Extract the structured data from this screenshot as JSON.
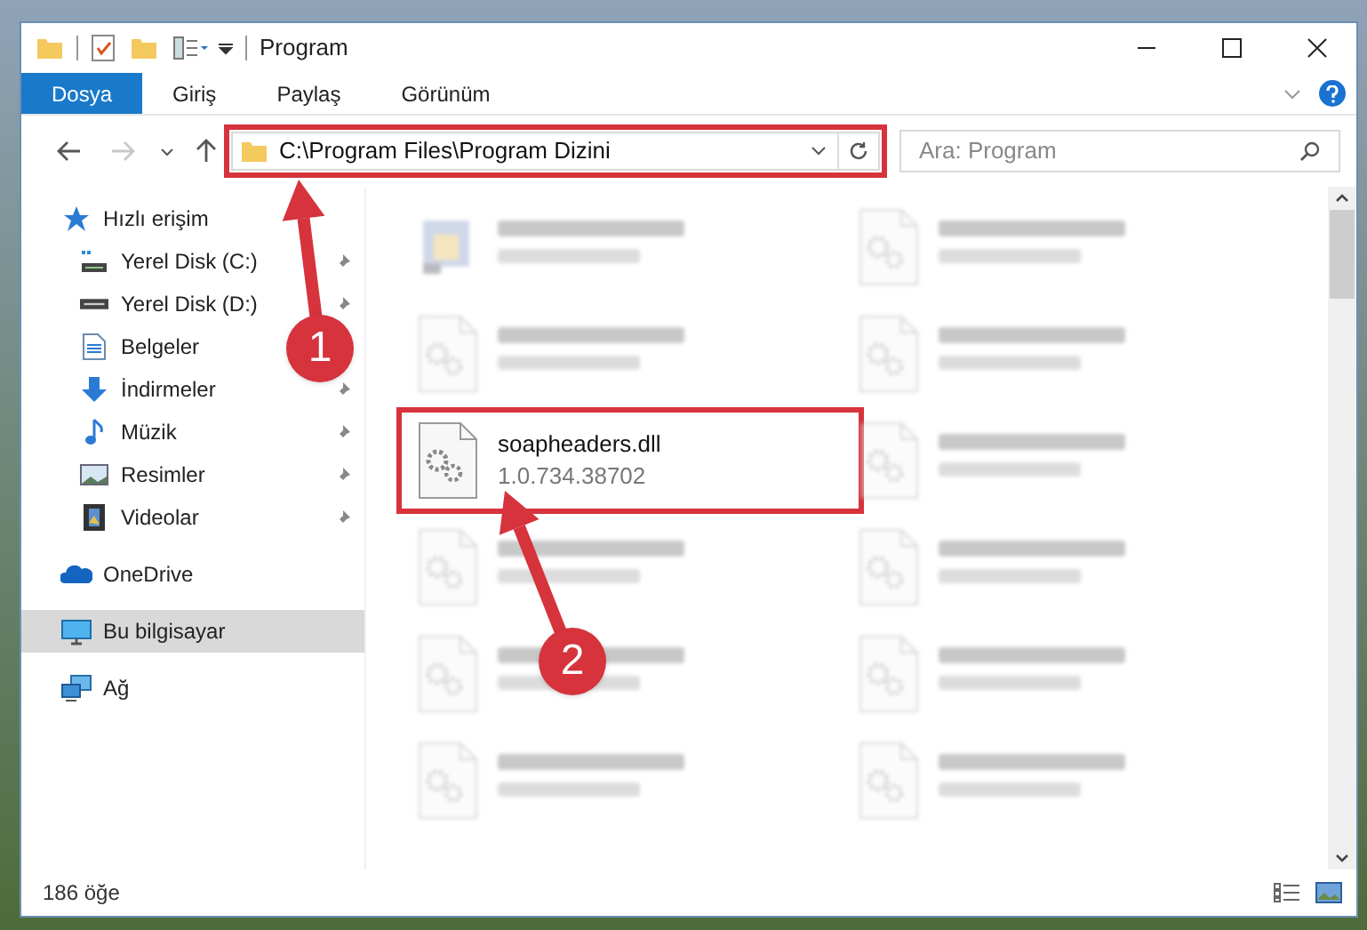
{
  "window": {
    "title": "Program"
  },
  "ribbon_tabs": [
    {
      "label": "Dosya",
      "selected": true
    },
    {
      "label": "Giriş",
      "selected": false
    },
    {
      "label": "Paylaş",
      "selected": false
    },
    {
      "label": "Görünüm",
      "selected": false
    }
  ],
  "address_bar": {
    "path": "C:\\Program Files\\Program Dizini"
  },
  "search": {
    "placeholder": "Ara: Program"
  },
  "sidebar": {
    "items": [
      {
        "label": "Hızlı erişim",
        "group": true,
        "pinned": false,
        "selected": false
      },
      {
        "label": "Yerel Disk (C:)",
        "group": false,
        "pinned": true,
        "selected": false
      },
      {
        "label": "Yerel Disk (D:)",
        "group": false,
        "pinned": true,
        "selected": false
      },
      {
        "label": "Belgeler",
        "group": false,
        "pinned": false,
        "selected": false
      },
      {
        "label": "İndirmeler",
        "group": false,
        "pinned": true,
        "selected": false
      },
      {
        "label": "Müzik",
        "group": false,
        "pinned": true,
        "selected": false
      },
      {
        "label": "Resimler",
        "group": false,
        "pinned": true,
        "selected": false
      },
      {
        "label": "Videolar",
        "group": false,
        "pinned": true,
        "selected": false
      },
      {
        "label": "OneDrive",
        "group": true,
        "pinned": false,
        "selected": false
      },
      {
        "label": "Bu bilgisayar",
        "group": true,
        "pinned": false,
        "selected": true
      },
      {
        "label": "Ağ",
        "group": true,
        "pinned": false,
        "selected": false
      }
    ]
  },
  "files": [
    {
      "kind": "exe",
      "blurred": true,
      "highlighted": false
    },
    {
      "kind": "dll",
      "blurred": true,
      "highlighted": false
    },
    {
      "kind": "dll",
      "blurred": true,
      "highlighted": false
    },
    {
      "kind": "dll",
      "blurred": true,
      "highlighted": false
    },
    {
      "name": "soapheaders.dll",
      "detail": "1.0.734.38702",
      "kind": "dll",
      "blurred": false,
      "highlighted": true
    },
    {
      "kind": "dll",
      "blurred": true,
      "highlighted": false
    },
    {
      "kind": "dll",
      "blurred": true,
      "highlighted": false
    },
    {
      "kind": "dll",
      "blurred": true,
      "highlighted": false
    },
    {
      "kind": "dll",
      "blurred": true,
      "highlighted": false
    },
    {
      "kind": "dll",
      "blurred": true,
      "highlighted": false
    },
    {
      "kind": "dll",
      "blurred": true,
      "highlighted": false
    },
    {
      "kind": "dll",
      "blurred": true,
      "highlighted": false
    }
  ],
  "status_bar": {
    "item_count": "186 öğe"
  },
  "callouts": [
    {
      "number": "1"
    },
    {
      "number": "2"
    }
  ]
}
